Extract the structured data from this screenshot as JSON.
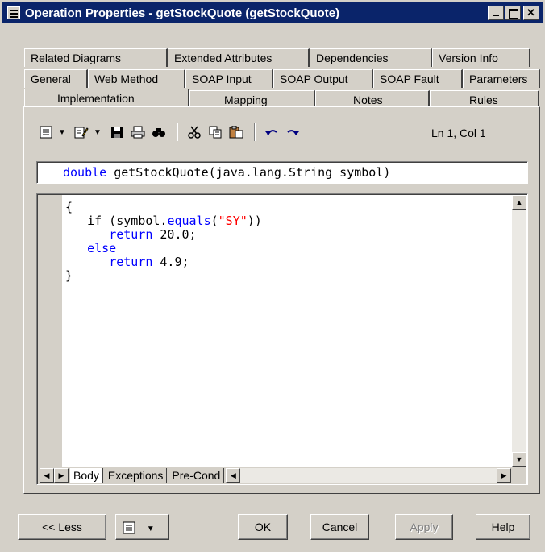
{
  "window": {
    "title": "Operation Properties - getStockQuote (getStockQuote)"
  },
  "tabs": {
    "row1": [
      "Related Diagrams",
      "Extended Attributes",
      "Dependencies",
      "Version Info"
    ],
    "row2": [
      "General",
      "Web Method",
      "SOAP Input",
      "SOAP Output",
      "SOAP Fault",
      "Parameters"
    ],
    "row3": [
      "Implementation",
      "Mapping",
      "Notes",
      "Rules"
    ],
    "active": "Implementation"
  },
  "toolbar": {
    "icons": [
      "list-icon",
      "edit-icon",
      "save-icon",
      "print-icon",
      "find-icon",
      "cut-icon",
      "copy-icon",
      "paste-icon",
      "undo-icon",
      "redo-icon"
    ],
    "position": "Ln 1, Col 1"
  },
  "signature": {
    "kw": "double",
    "rest": " getStockQuote(java.lang.String symbol)"
  },
  "code": {
    "l1": "{",
    "l2_a": "   if (symbol.",
    "l2_b": "equals",
    "l2_c": "(",
    "l2_d": "\"SY\"",
    "l2_e": "))",
    "l3_a": "      ",
    "l3_b": "return",
    "l3_c": " 20.0;",
    "l4_a": "   ",
    "l4_b": "else",
    "l5_a": "      ",
    "l5_b": "return",
    "l5_c": " 4.9;",
    "l6": "}"
  },
  "sheets": [
    "Body",
    "Exceptions",
    "Pre-Cond"
  ],
  "buttons": {
    "less": "<< Less",
    "ok": "OK",
    "cancel": "Cancel",
    "apply": "Apply",
    "help": "Help"
  }
}
